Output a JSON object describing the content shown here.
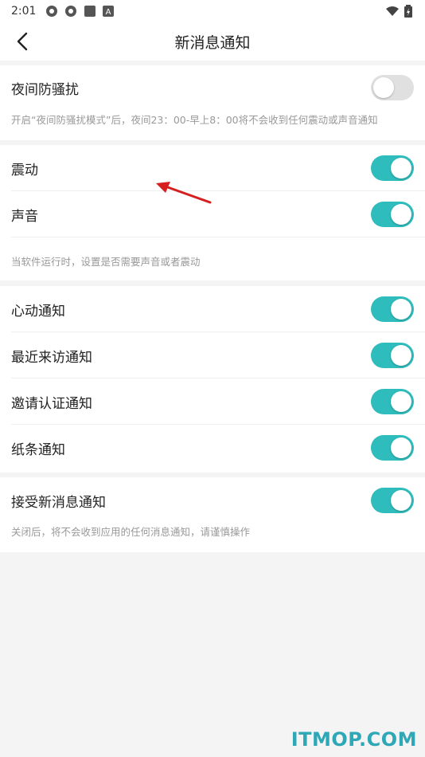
{
  "status_bar": {
    "time": "2:01",
    "left_icons": [
      "aperture-icon",
      "aperture-icon",
      "square-icon",
      "a-badge-icon"
    ],
    "right_icons": [
      "wifi-icon",
      "battery-charging-icon"
    ]
  },
  "header": {
    "title": "新消息通知",
    "back_icon": "chevron-left-icon"
  },
  "sections": {
    "night": {
      "label": "夜间防骚扰",
      "toggle_on": false,
      "hint": "开启“夜间防骚扰模式”后，夜间23：00-早上8：00将不会收到任何震动或声音通知"
    },
    "sound": {
      "vibrate_label": "震动",
      "vibrate_on": true,
      "sound_label": "声音",
      "sound_on": true,
      "hint": "当软件运行时，设置是否需要声音或者震动"
    },
    "notify": {
      "items": [
        {
          "label": "心动通知",
          "on": true
        },
        {
          "label": "最近来访通知",
          "on": true
        },
        {
          "label": "邀请认证通知",
          "on": true
        },
        {
          "label": "纸条通知",
          "on": true
        }
      ]
    },
    "accept": {
      "label": "接受新消息通知",
      "toggle_on": true,
      "hint": "关闭后，将不会收到应用的任何消息通知，请谨慎操作"
    }
  },
  "watermark": "ITMOP.COM",
  "colors": {
    "toggle_on": "#2fbcbc",
    "toggle_off": "#e0e0e0",
    "annotation_arrow": "#d62020",
    "watermark": "#2ea7b6"
  }
}
